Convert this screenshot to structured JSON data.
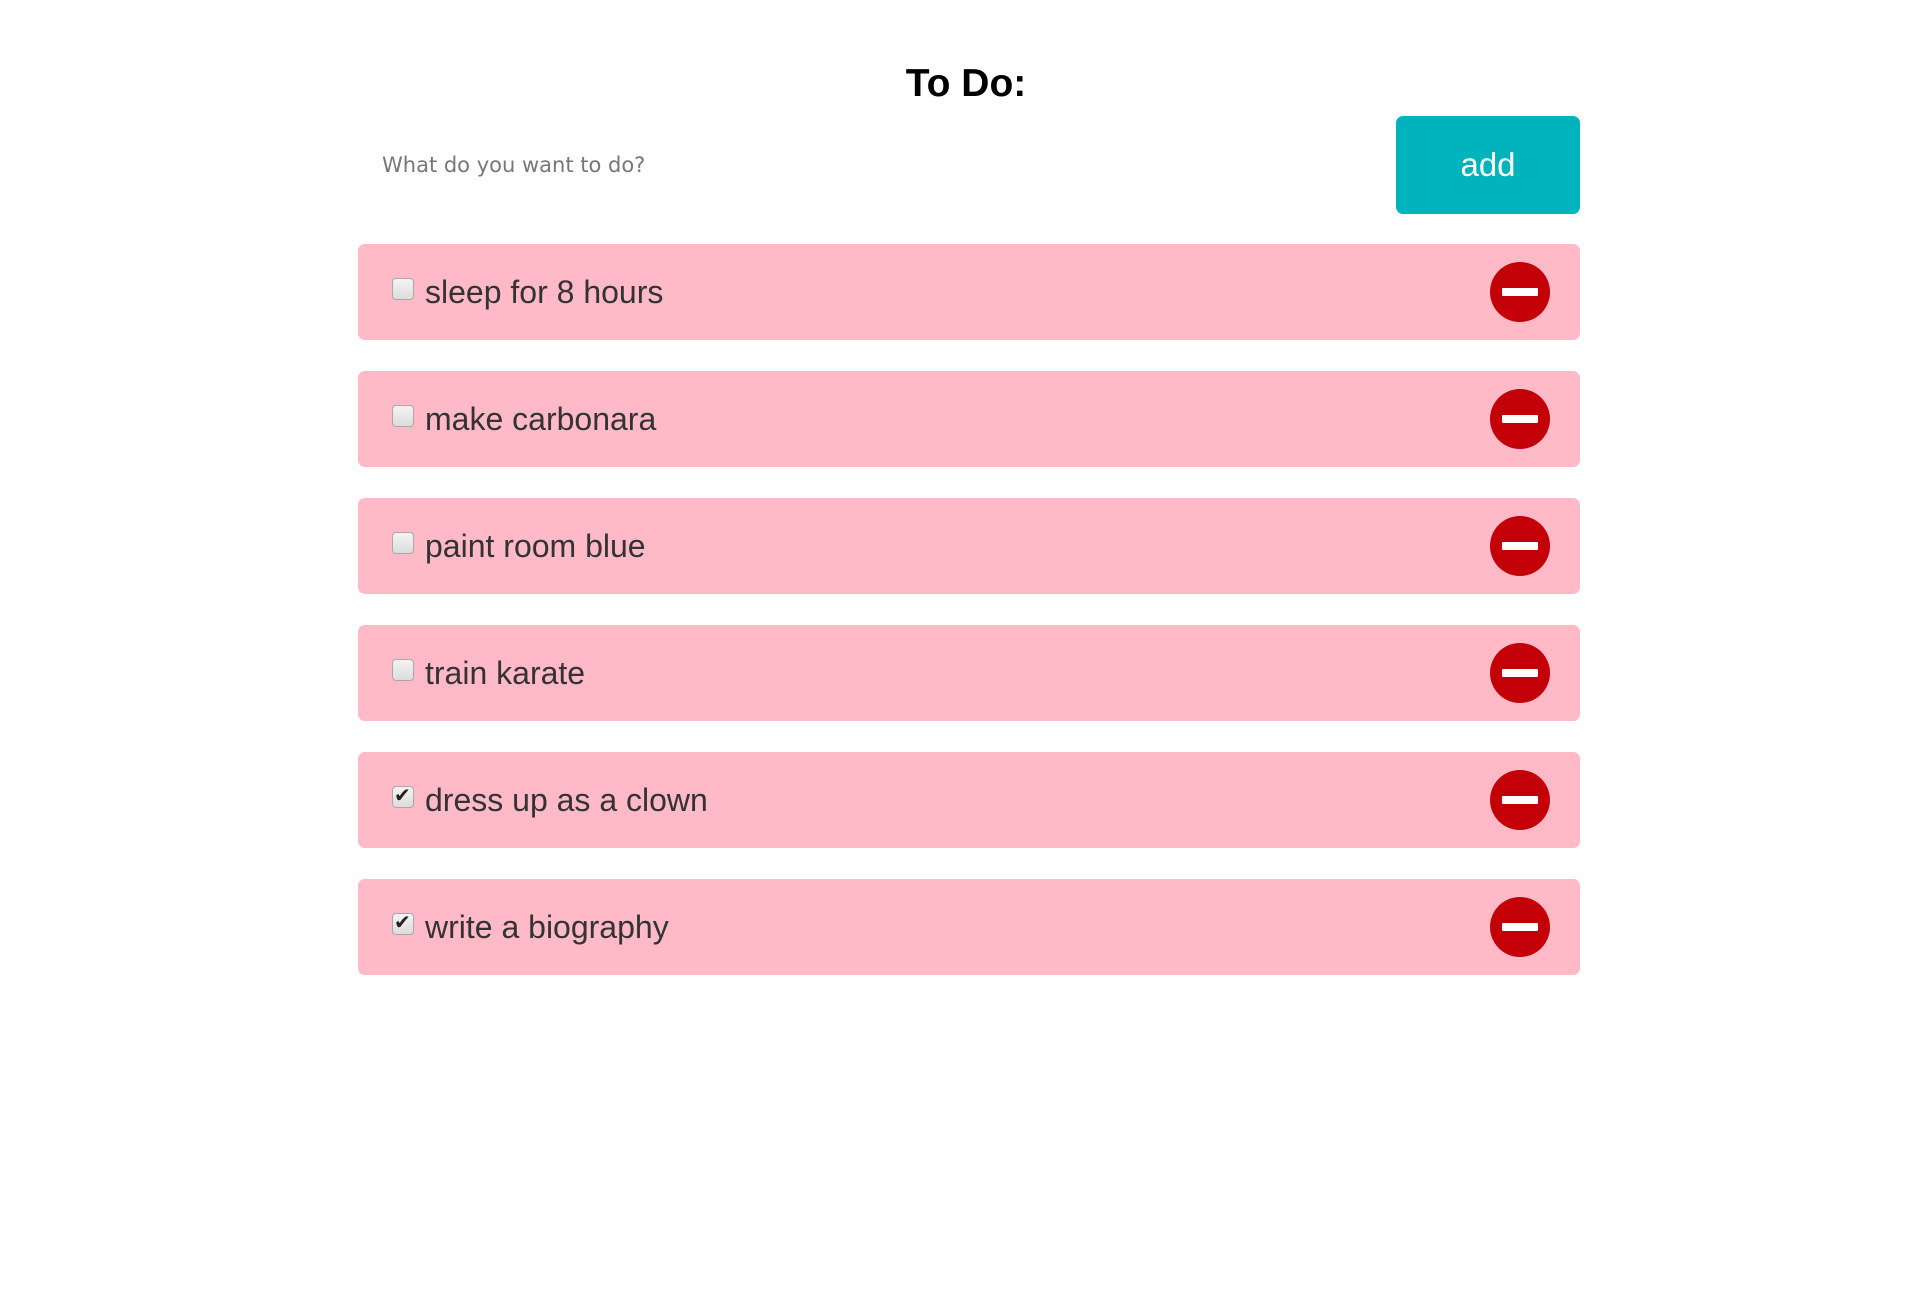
{
  "header": {
    "title": "To Do:"
  },
  "new_todo": {
    "placeholder": "What do you want to do?",
    "value": "",
    "add_label": "add"
  },
  "todos": [
    {
      "text": "sleep for 8 hours",
      "checked": false
    },
    {
      "text": "make carbonara",
      "checked": false
    },
    {
      "text": "paint room blue",
      "checked": false
    },
    {
      "text": "train karate",
      "checked": false
    },
    {
      "text": "dress up as a clown",
      "checked": true
    },
    {
      "text": "write a biography",
      "checked": true
    }
  ],
  "icons": {
    "remove": "minus-circle-icon",
    "checked": "checkmark-icon"
  },
  "colors": {
    "accent": "#00b3bd",
    "item_background": "#ffb9c7",
    "remove_button": "#c30007",
    "text": "#333333"
  }
}
